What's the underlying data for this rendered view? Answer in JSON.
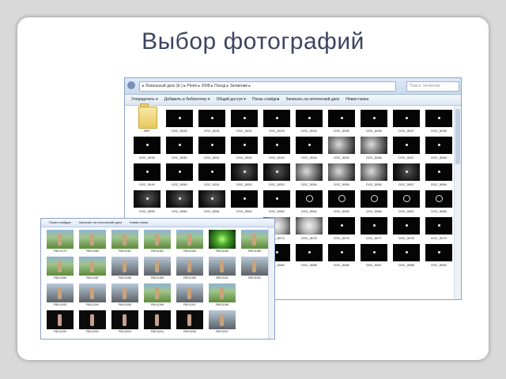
{
  "slide": {
    "title": "Выбор фотографий"
  },
  "big_window": {
    "address": "▸ Локальный диск (E:) ▸ Photo ▸ 2008 ▸ Поход ▸ Затмение ▸",
    "search_placeholder": "Поиск: Затмение",
    "toolbar": [
      "Упорядочить ▾",
      "Добавить в библиотеку ▾",
      "Общий доступ ▾",
      "Показ слайдов",
      "Записать на оптический диск",
      "Новая папка"
    ],
    "items": [
      {
        "name": "NEF",
        "kind": "folder"
      },
      {
        "name": "DSC_5030",
        "kind": "dot"
      },
      {
        "name": "DSC_5031",
        "kind": "dot"
      },
      {
        "name": "DSC_5032",
        "kind": "dot"
      },
      {
        "name": "DSC_5033",
        "kind": "dot"
      },
      {
        "name": "DSC_5034",
        "kind": "dot"
      },
      {
        "name": "DSC_5035",
        "kind": "dot"
      },
      {
        "name": "DSC_5036",
        "kind": "dot"
      },
      {
        "name": "DSC_5037",
        "kind": "dot"
      },
      {
        "name": "DSC_5038",
        "kind": "dot"
      },
      {
        "name": "DSC_5039",
        "kind": "dot"
      },
      {
        "name": "DSC_5040",
        "kind": "dot"
      },
      {
        "name": "DSC_5041",
        "kind": "dot"
      },
      {
        "name": "DSC_5042",
        "kind": "dot"
      },
      {
        "name": "DSC_5043",
        "kind": "dot"
      },
      {
        "name": "DSC_5044",
        "kind": "dot"
      },
      {
        "name": "DSC_5045",
        "kind": "cloud"
      },
      {
        "name": "DSC_5046",
        "kind": "cloud"
      },
      {
        "name": "DSC_5047",
        "kind": "dot"
      },
      {
        "name": "DSC_5048",
        "kind": "dot"
      },
      {
        "name": "DSC_5049",
        "kind": "dot"
      },
      {
        "name": "DSC_5050",
        "kind": "dot"
      },
      {
        "name": "DSC_5051",
        "kind": "dot"
      },
      {
        "name": "DSC_5052",
        "kind": "dim"
      },
      {
        "name": "DSC_5053",
        "kind": "dim"
      },
      {
        "name": "DSC_5054",
        "kind": "cloud"
      },
      {
        "name": "DSC_5055",
        "kind": "cloud"
      },
      {
        "name": "DSC_5056",
        "kind": "cloud"
      },
      {
        "name": "DSC_5057",
        "kind": "dim"
      },
      {
        "name": "DSC_5058",
        "kind": "dot"
      },
      {
        "name": "DSC_5059",
        "kind": "dim"
      },
      {
        "name": "DSC_5060",
        "kind": "dim"
      },
      {
        "name": "DSC_5061",
        "kind": "dim"
      },
      {
        "name": "DSC_5062",
        "kind": "dot"
      },
      {
        "name": "DSC_5063",
        "kind": "dot"
      },
      {
        "name": "DSC_5064",
        "kind": "ring"
      },
      {
        "name": "DSC_5065",
        "kind": "ring"
      },
      {
        "name": "DSC_5066",
        "kind": "ring"
      },
      {
        "name": "DSC_5067",
        "kind": "ring"
      },
      {
        "name": "DSC_5068",
        "kind": "ring"
      },
      {
        "name": "",
        "kind": "hidden"
      },
      {
        "name": "",
        "kind": "hidden"
      },
      {
        "name": "",
        "kind": "hidden"
      },
      {
        "name": "",
        "kind": "hidden"
      },
      {
        "name": "DSC_5074",
        "kind": "bright"
      },
      {
        "name": "DSC_5075",
        "kind": "bright"
      },
      {
        "name": "DSC_5076",
        "kind": "dot"
      },
      {
        "name": "DSC_5077",
        "kind": "dot"
      },
      {
        "name": "DSC_5078",
        "kind": "dot"
      },
      {
        "name": "DSC_5079",
        "kind": "dot"
      },
      {
        "name": "",
        "kind": "hidden"
      },
      {
        "name": "",
        "kind": "hidden"
      },
      {
        "name": "",
        "kind": "hidden"
      },
      {
        "name": "",
        "kind": "hidden"
      },
      {
        "name": "DSC_5084",
        "kind": "dot"
      },
      {
        "name": "DSC_5085",
        "kind": "dot"
      },
      {
        "name": "DSC_5086",
        "kind": "dot"
      },
      {
        "name": "DSC_5087",
        "kind": "dot"
      },
      {
        "name": "DSC_5088",
        "kind": "dot"
      },
      {
        "name": "DSC_5089",
        "kind": "dot"
      }
    ]
  },
  "small_window": {
    "toolbar": [
      "Показ слайдов",
      "Записать на оптический диск",
      "Новая папка"
    ],
    "items": [
      {
        "name": "P8013179",
        "kind": "grass"
      },
      {
        "name": "P8013180",
        "kind": "grass"
      },
      {
        "name": "P8013181",
        "kind": "grass"
      },
      {
        "name": "P8013182",
        "kind": "grass"
      },
      {
        "name": "P8013183",
        "kind": "grass"
      },
      {
        "name": "P8013184",
        "kind": "green"
      },
      {
        "name": "P8013185",
        "kind": "grass"
      },
      {
        "name": "P8013186",
        "kind": "grass"
      },
      {
        "name": "P8013187",
        "kind": "grass"
      },
      {
        "name": "P8013188",
        "kind": "road"
      },
      {
        "name": "P8013189",
        "kind": "road"
      },
      {
        "name": "P8013190",
        "kind": "road"
      },
      {
        "name": "P8013191",
        "kind": "road"
      },
      {
        "name": "P8013192",
        "kind": "road"
      },
      {
        "name": "P8013193",
        "kind": "road"
      },
      {
        "name": "P8013194",
        "kind": "road"
      },
      {
        "name": "P8013195",
        "kind": "road"
      },
      {
        "name": "P8013196",
        "kind": "grass"
      },
      {
        "name": "P8013197",
        "kind": "road"
      },
      {
        "name": "P8013198",
        "kind": "grass"
      },
      {
        "name": "",
        "kind": "hidden"
      },
      {
        "name": "P8013199",
        "kind": "night"
      },
      {
        "name": "P8013202",
        "kind": "night"
      },
      {
        "name": "P8013203",
        "kind": "night"
      },
      {
        "name": "P8013204",
        "kind": "night"
      },
      {
        "name": "P8013206",
        "kind": "night"
      },
      {
        "name": "P8013207",
        "kind": "road"
      },
      {
        "name": "",
        "kind": "hidden"
      }
    ]
  }
}
